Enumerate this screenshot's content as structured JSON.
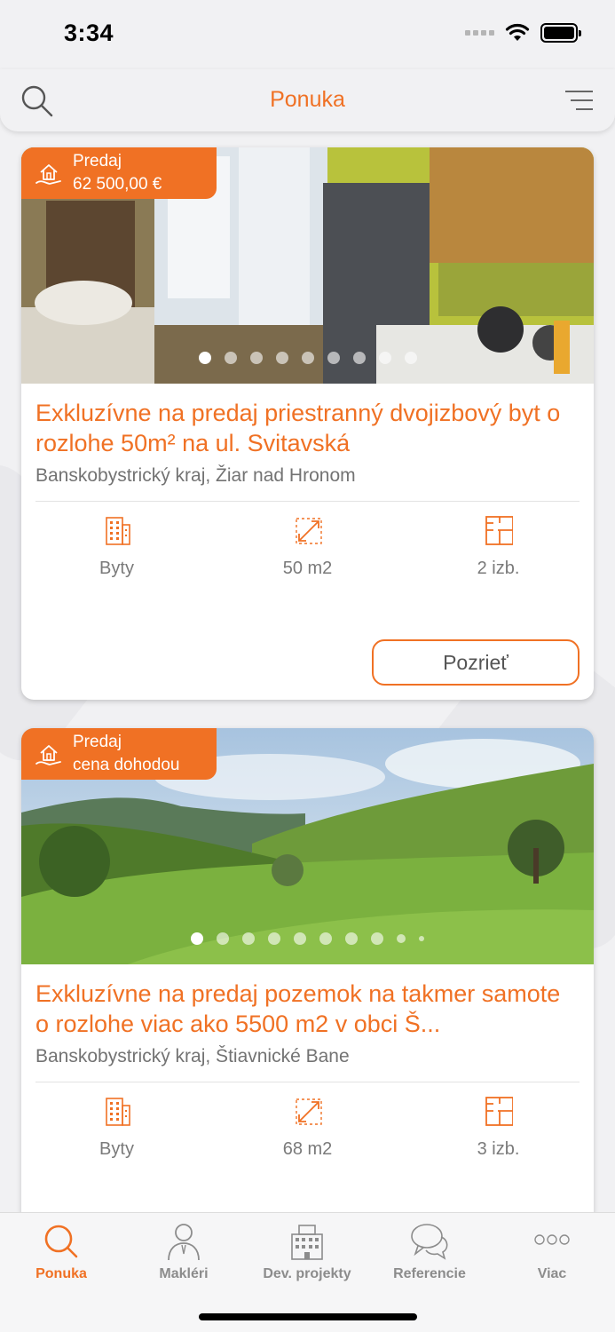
{
  "status_bar": {
    "time": "3:34"
  },
  "nav": {
    "title": "Ponuka"
  },
  "colors": {
    "accent": "#f07124",
    "text_muted": "#737373",
    "background": "#f1f1f3"
  },
  "listings": [
    {
      "badge_type": "Predaj",
      "badge_price": "62 500,00 €",
      "title": " Exkluzívne na predaj priestranný dvojizbový byt o rozlohe 50m² na ul. Svitavská",
      "location": "Banskobystrický kraj, Žiar nad Hronom",
      "features": [
        {
          "icon": "building-icon",
          "label": "Byty"
        },
        {
          "icon": "area-icon",
          "label": "50 m2"
        },
        {
          "icon": "floorplan-icon",
          "label": "2 izb."
        }
      ],
      "view_label": "Pozrieť",
      "photo_count": 9,
      "active_photo": 1
    },
    {
      "badge_type": "Predaj",
      "badge_price": "cena dohodou",
      "title": "Exkluzívne na predaj pozemok na takmer samote o rozlohe viac ako 5500 m2 v obci Š...",
      "location": "Banskobystrický kraj, Štiavnické Bane",
      "features": [
        {
          "icon": "building-icon",
          "label": "Byty"
        },
        {
          "icon": "area-icon",
          "label": "68 m2"
        },
        {
          "icon": "floorplan-icon",
          "label": "3 izb."
        }
      ],
      "photo_count": 10,
      "active_photo": 1
    }
  ],
  "tabs": [
    {
      "label": "Ponuka",
      "icon": "search-icon",
      "active": true
    },
    {
      "label": "Makléri",
      "icon": "person-icon",
      "active": false
    },
    {
      "label": "Dev. projekty",
      "icon": "building-icon",
      "active": false
    },
    {
      "label": "Referencie",
      "icon": "chat-bubbles-icon",
      "active": false
    },
    {
      "label": "Viac",
      "icon": "more-icon",
      "active": false
    }
  ]
}
